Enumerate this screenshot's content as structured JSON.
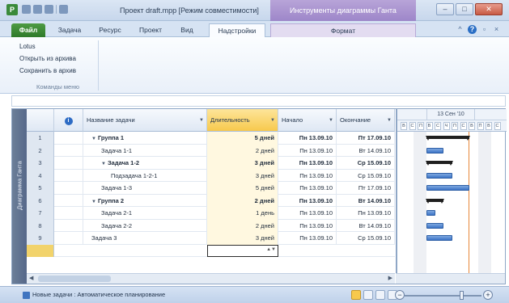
{
  "window": {
    "app_icon": "P",
    "title": "Проект draft.mpp [Режим совместимости]",
    "context_title": "Инструменты диаграммы Ганта",
    "minimize": "–",
    "maximize": "□",
    "close": "✕"
  },
  "ribbon": {
    "tabs": [
      "Файл",
      "Задача",
      "Ресурс",
      "Проект",
      "Вид",
      "Надстройки",
      "Формат"
    ],
    "active_tab": "Надстройки",
    "help": "?",
    "group": {
      "items": [
        "Lotus",
        "Открыть из архива",
        "Сохранить в архив"
      ],
      "label": "Команды меню"
    }
  },
  "view_label": "Диаграмма Ганта",
  "table": {
    "headers": {
      "info": "i",
      "name": "Название задачи",
      "duration": "Длительность",
      "start": "Начало",
      "finish": "Окончание"
    },
    "rows": [
      {
        "num": "1",
        "name": "Группа 1",
        "duration": "5 дней",
        "start": "Пн 13.09.10",
        "finish": "Пт 17.09.10",
        "level": 0,
        "summary": true
      },
      {
        "num": "2",
        "name": "Задача 1-1",
        "duration": "2 дней",
        "start": "Пн 13.09.10",
        "finish": "Вт 14.09.10",
        "level": 1,
        "summary": false
      },
      {
        "num": "3",
        "name": "Задача 1-2",
        "duration": "3 дней",
        "start": "Пн 13.09.10",
        "finish": "Ср 15.09.10",
        "level": 1,
        "summary": true
      },
      {
        "num": "4",
        "name": "Подзадача 1-2-1",
        "duration": "3 дней",
        "start": "Пн 13.09.10",
        "finish": "Ср 15.09.10",
        "level": 2,
        "summary": false
      },
      {
        "num": "5",
        "name": "Задача 1-3",
        "duration": "5 дней",
        "start": "Пн 13.09.10",
        "finish": "Пт 17.09.10",
        "level": 1,
        "summary": false
      },
      {
        "num": "6",
        "name": "Группа 2",
        "duration": "2 дней",
        "start": "Пн 13.09.10",
        "finish": "Вт 14.09.10",
        "level": 0,
        "summary": true
      },
      {
        "num": "7",
        "name": "Задача 2-1",
        "duration": "1 день",
        "start": "Пн 13.09.10",
        "finish": "Пн 13.09.10",
        "level": 1,
        "summary": false
      },
      {
        "num": "8",
        "name": "Задача 2-2",
        "duration": "2 дней",
        "start": "Пн 13.09.10",
        "finish": "Вт 14.09.10",
        "level": 1,
        "summary": false
      },
      {
        "num": "9",
        "name": "Задача 3",
        "duration": "3 дней",
        "start": "Пн 13.09.10",
        "finish": "Ср 15.09.10",
        "level": 0,
        "summary": false
      }
    ]
  },
  "gantt": {
    "week_label": "13 Сен '10",
    "days": [
      "В",
      "С",
      "П",
      "В",
      "С",
      "Ч",
      "П",
      "С",
      "В",
      "П",
      "В",
      "С"
    ]
  },
  "statusbar": {
    "text": "Новые задачи : Автоматическое планирование",
    "zoom_minus": "−",
    "zoom_plus": "+"
  },
  "colors": {
    "accent": "#f7c94d",
    "bar": "#3b73c6",
    "file_tab": "#2e7a2a",
    "context": "#9d86c9"
  }
}
